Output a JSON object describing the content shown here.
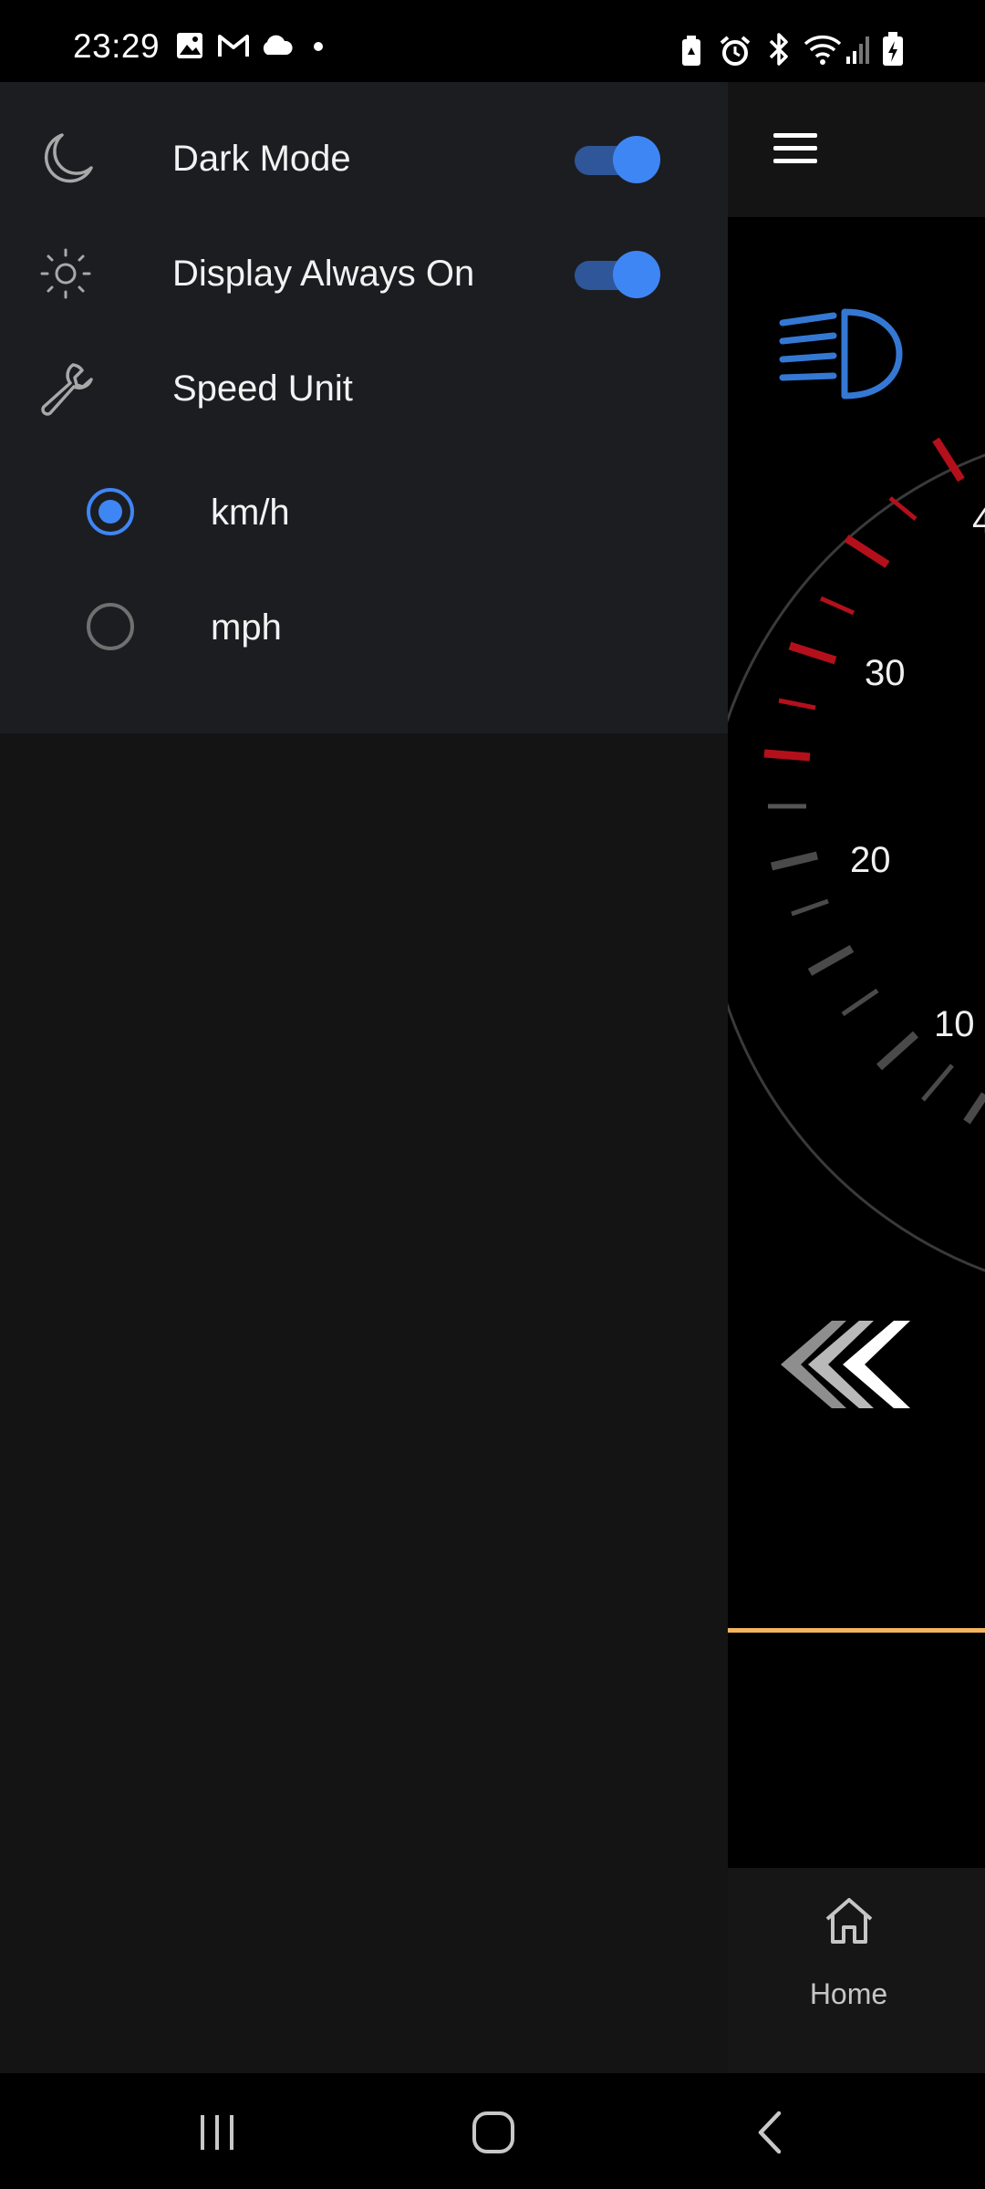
{
  "status_bar": {
    "time": "23:29",
    "left_icons": [
      "gallery-icon",
      "gmail-icon",
      "cloud-icon",
      "dot-icon"
    ],
    "right_icons": [
      "battery-saver-icon",
      "alarm-icon",
      "bluetooth-icon",
      "wifi-icon",
      "signal-icon",
      "battery-charging-icon"
    ]
  },
  "drawer": {
    "settings": [
      {
        "icon": "moon-icon",
        "label": "Dark Mode",
        "toggle": true
      },
      {
        "icon": "sun-icon",
        "label": "Display Always On",
        "toggle": true
      },
      {
        "icon": "wrench-icon",
        "label": "Speed Unit"
      }
    ],
    "speed_unit_options": [
      {
        "label": "km/h",
        "selected": true
      },
      {
        "label": "mph",
        "selected": false
      }
    ]
  },
  "main": {
    "menu_icon": "hamburger-menu-icon",
    "headlight_icon": "headlight-icon",
    "speed_ticks": [
      "30",
      "20",
      "10"
    ],
    "turn_signal_icon": "left-chevrons-icon",
    "bottom_nav": {
      "home_label": "Home",
      "home_icon": "home-icon"
    }
  },
  "colors": {
    "accent": "#3f86f5",
    "drawer_bg": "#1c1d21",
    "redline": "#b3101b",
    "orange_line": "#f4b460"
  },
  "system_nav": [
    "recent-apps-icon",
    "home-button-icon",
    "back-icon"
  ]
}
